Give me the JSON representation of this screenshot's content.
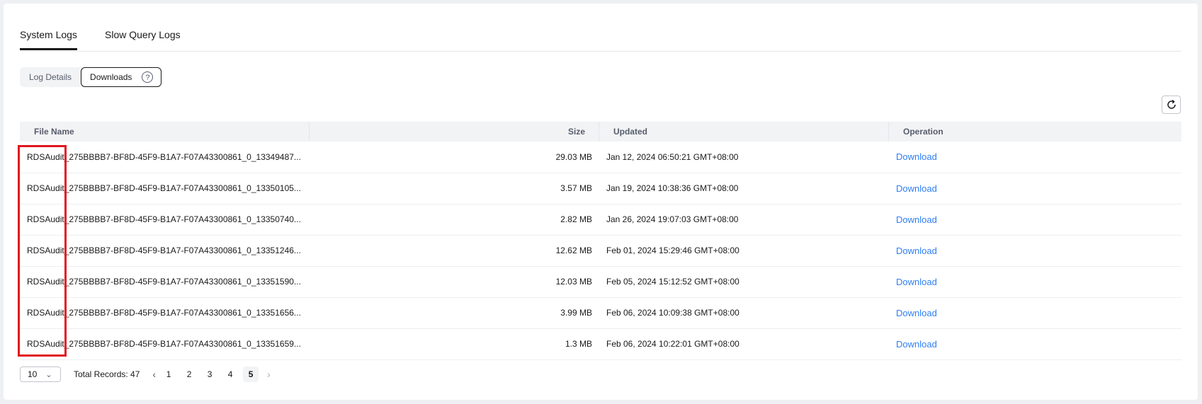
{
  "tabs": [
    {
      "label": "System Logs",
      "active": true
    },
    {
      "label": "Slow Query Logs",
      "active": false
    }
  ],
  "segment": {
    "items": [
      {
        "label": "Log Details",
        "active": false
      },
      {
        "label": "Downloads",
        "active": true
      }
    ],
    "help_icon": "?"
  },
  "toolbar": {
    "refresh_icon": "refresh-icon"
  },
  "table": {
    "columns": [
      "File Name",
      "Size",
      "Updated",
      "Operation"
    ],
    "rows": [
      {
        "name": "RDSAudit_275BBBB7-BF8D-45F9-B1A7-F07A43300861_0_13349487...",
        "size": "29.03 MB",
        "updated": "Jan 12, 2024 06:50:21 GMT+08:00",
        "op": "Download"
      },
      {
        "name": "RDSAudit_275BBBB7-BF8D-45F9-B1A7-F07A43300861_0_13350105...",
        "size": "3.57 MB",
        "updated": "Jan 19, 2024 10:38:36 GMT+08:00",
        "op": "Download"
      },
      {
        "name": "RDSAudit_275BBBB7-BF8D-45F9-B1A7-F07A43300861_0_13350740...",
        "size": "2.82 MB",
        "updated": "Jan 26, 2024 19:07:03 GMT+08:00",
        "op": "Download"
      },
      {
        "name": "RDSAudit_275BBBB7-BF8D-45F9-B1A7-F07A43300861_0_13351246...",
        "size": "12.62 MB",
        "updated": "Feb 01, 2024 15:29:46 GMT+08:00",
        "op": "Download"
      },
      {
        "name": "RDSAudit_275BBBB7-BF8D-45F9-B1A7-F07A43300861_0_13351590...",
        "size": "12.03 MB",
        "updated": "Feb 05, 2024 15:12:52 GMT+08:00",
        "op": "Download"
      },
      {
        "name": "RDSAudit_275BBBB7-BF8D-45F9-B1A7-F07A43300861_0_13351656...",
        "size": "3.99 MB",
        "updated": "Feb 06, 2024 10:09:38 GMT+08:00",
        "op": "Download"
      },
      {
        "name": "RDSAudit_275BBBB7-BF8D-45F9-B1A7-F07A43300861_0_13351659...",
        "size": "1.3 MB",
        "updated": "Feb 06, 2024 10:22:01 GMT+08:00",
        "op": "Download"
      }
    ]
  },
  "pagination": {
    "page_size": "10",
    "total_label": "Total Records: 47",
    "pages": [
      "1",
      "2",
      "3",
      "4",
      "5"
    ],
    "current_page": "5"
  },
  "colors": {
    "link": "#2f7ef5",
    "highlight": "#e0161f",
    "header_bg": "#f2f3f5"
  }
}
